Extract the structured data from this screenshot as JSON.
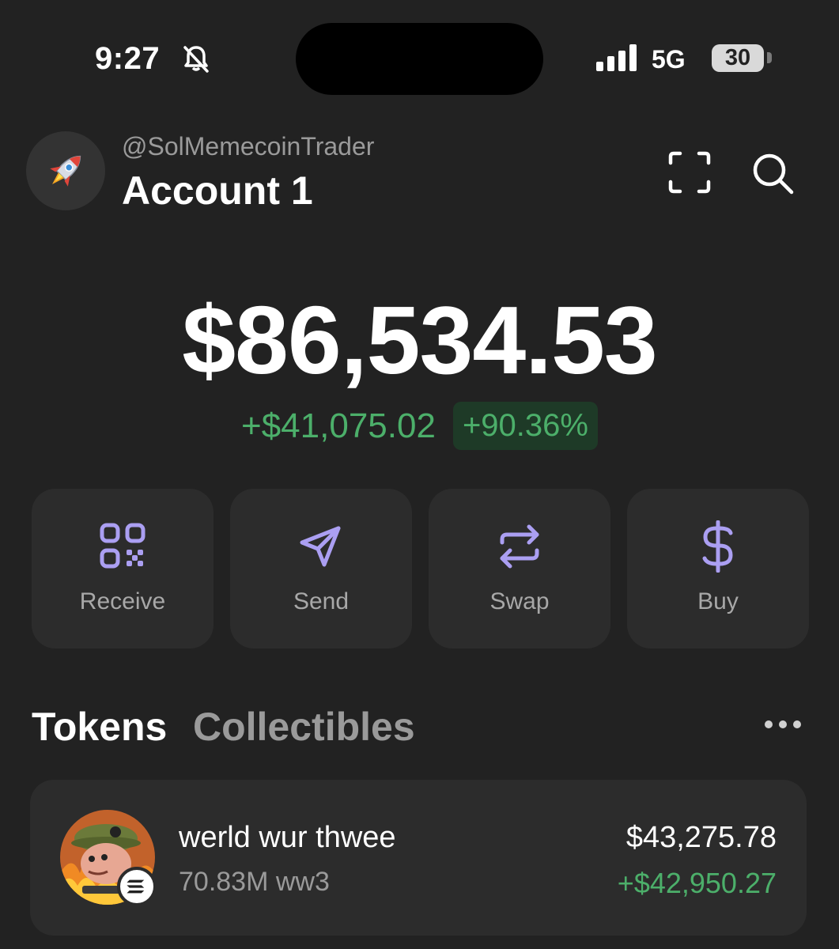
{
  "status_bar": {
    "time": "9:27",
    "network": "5G",
    "battery": "30"
  },
  "header": {
    "username": "@SolMemecoinTrader",
    "account_name": "Account 1",
    "avatar_icon": "rocket-icon"
  },
  "balance": {
    "total": "$86,534.53",
    "change_amount": "+$41,075.02",
    "change_percent": "+90.36%"
  },
  "actions": [
    {
      "label": "Receive",
      "icon": "qr-code-icon"
    },
    {
      "label": "Send",
      "icon": "send-icon"
    },
    {
      "label": "Swap",
      "icon": "swap-icon"
    },
    {
      "label": "Buy",
      "icon": "dollar-icon"
    }
  ],
  "tabs": {
    "tokens": "Tokens",
    "collectibles": "Collectibles"
  },
  "tokens": [
    {
      "name": "werld wur thwee",
      "amount": "70.83M ww3",
      "value": "$43,275.78",
      "change": "+$42,950.27"
    }
  ],
  "colors": {
    "accent": "#ab9ff2",
    "positive": "#4caf6a",
    "background": "#222222",
    "card": "#2c2c2c"
  }
}
